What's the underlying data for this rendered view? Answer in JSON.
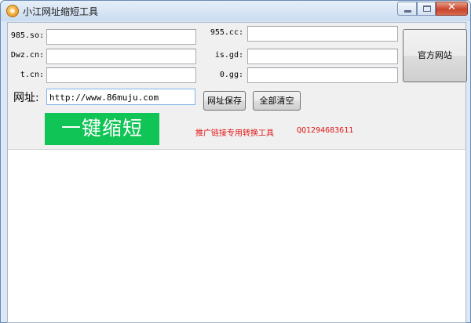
{
  "window": {
    "title": "小江网址缩短工具",
    "close_glyph": "✕"
  },
  "shorteners": {
    "left": [
      {
        "label": "985.so:",
        "value": ""
      },
      {
        "label": "Dwz.cn:",
        "value": ""
      },
      {
        "label": "t.cn:",
        "value": ""
      }
    ],
    "right": [
      {
        "label": "955.cc:",
        "value": ""
      },
      {
        "label": "is.gd:",
        "value": ""
      },
      {
        "label": "0.gg:",
        "value": ""
      }
    ]
  },
  "official_site_button": "官方网站",
  "url": {
    "label": "网址:",
    "value": "http://www.86muju.com"
  },
  "buttons": {
    "save": "网址保存",
    "clear_all": "全部清空",
    "shorten": "一键缩短"
  },
  "promo": {
    "text": "推广链接专用转换工具",
    "qq": "QQ1294683611",
    "color": "#e21616"
  },
  "colors": {
    "shorten_button": "#10c455"
  }
}
